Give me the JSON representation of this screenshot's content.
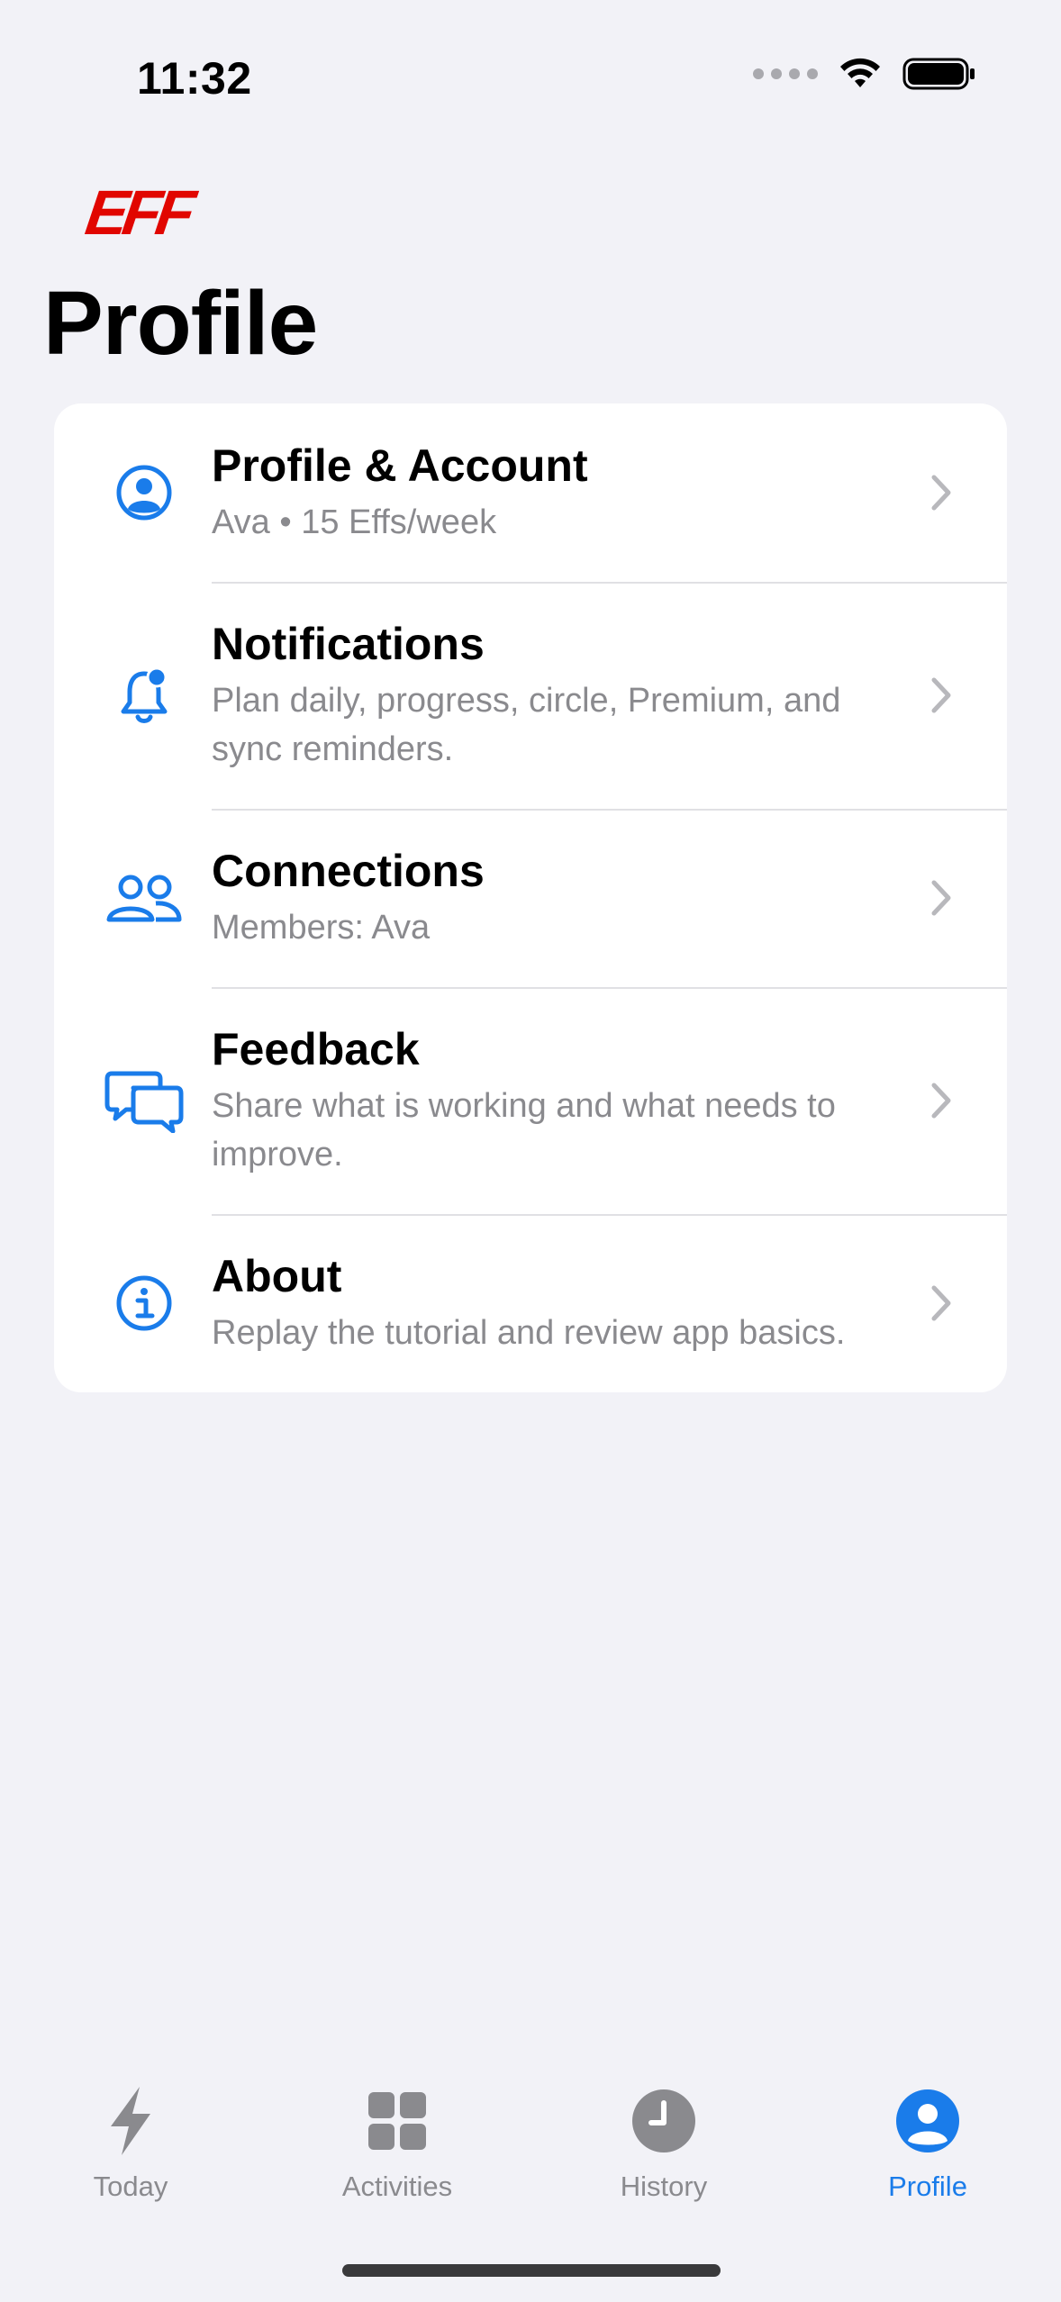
{
  "status_bar": {
    "time": "11:32"
  },
  "app": {
    "logo_text": "EFF"
  },
  "page": {
    "title": "Profile"
  },
  "menu": {
    "items": [
      {
        "title": "Profile & Account",
        "subtitle": "Ava • 15 Effs/week",
        "icon": "person-circle-icon"
      },
      {
        "title": "Notifications",
        "subtitle": "Plan daily, progress, circle, Premium, and sync reminders.",
        "icon": "bell-badge-icon"
      },
      {
        "title": "Connections",
        "subtitle": "Members: Ava",
        "icon": "people-icon"
      },
      {
        "title": "Feedback",
        "subtitle": "Share what is working and what needs to improve.",
        "icon": "chat-bubbles-icon"
      },
      {
        "title": "About",
        "subtitle": "Replay the tutorial and review app basics.",
        "icon": "info-circle-icon"
      }
    ]
  },
  "tabbar": {
    "tabs": [
      {
        "label": "Today",
        "icon": "bolt-icon",
        "active": false
      },
      {
        "label": "Activities",
        "icon": "grid-icon",
        "active": false
      },
      {
        "label": "History",
        "icon": "clock-icon",
        "active": false
      },
      {
        "label": "Profile",
        "icon": "person-circle-fill-icon",
        "active": true
      }
    ]
  },
  "colors": {
    "accent": "#1A7CEA",
    "logo": "#E10600",
    "background": "#F2F2F7",
    "secondary_text": "#8A8A8E"
  }
}
